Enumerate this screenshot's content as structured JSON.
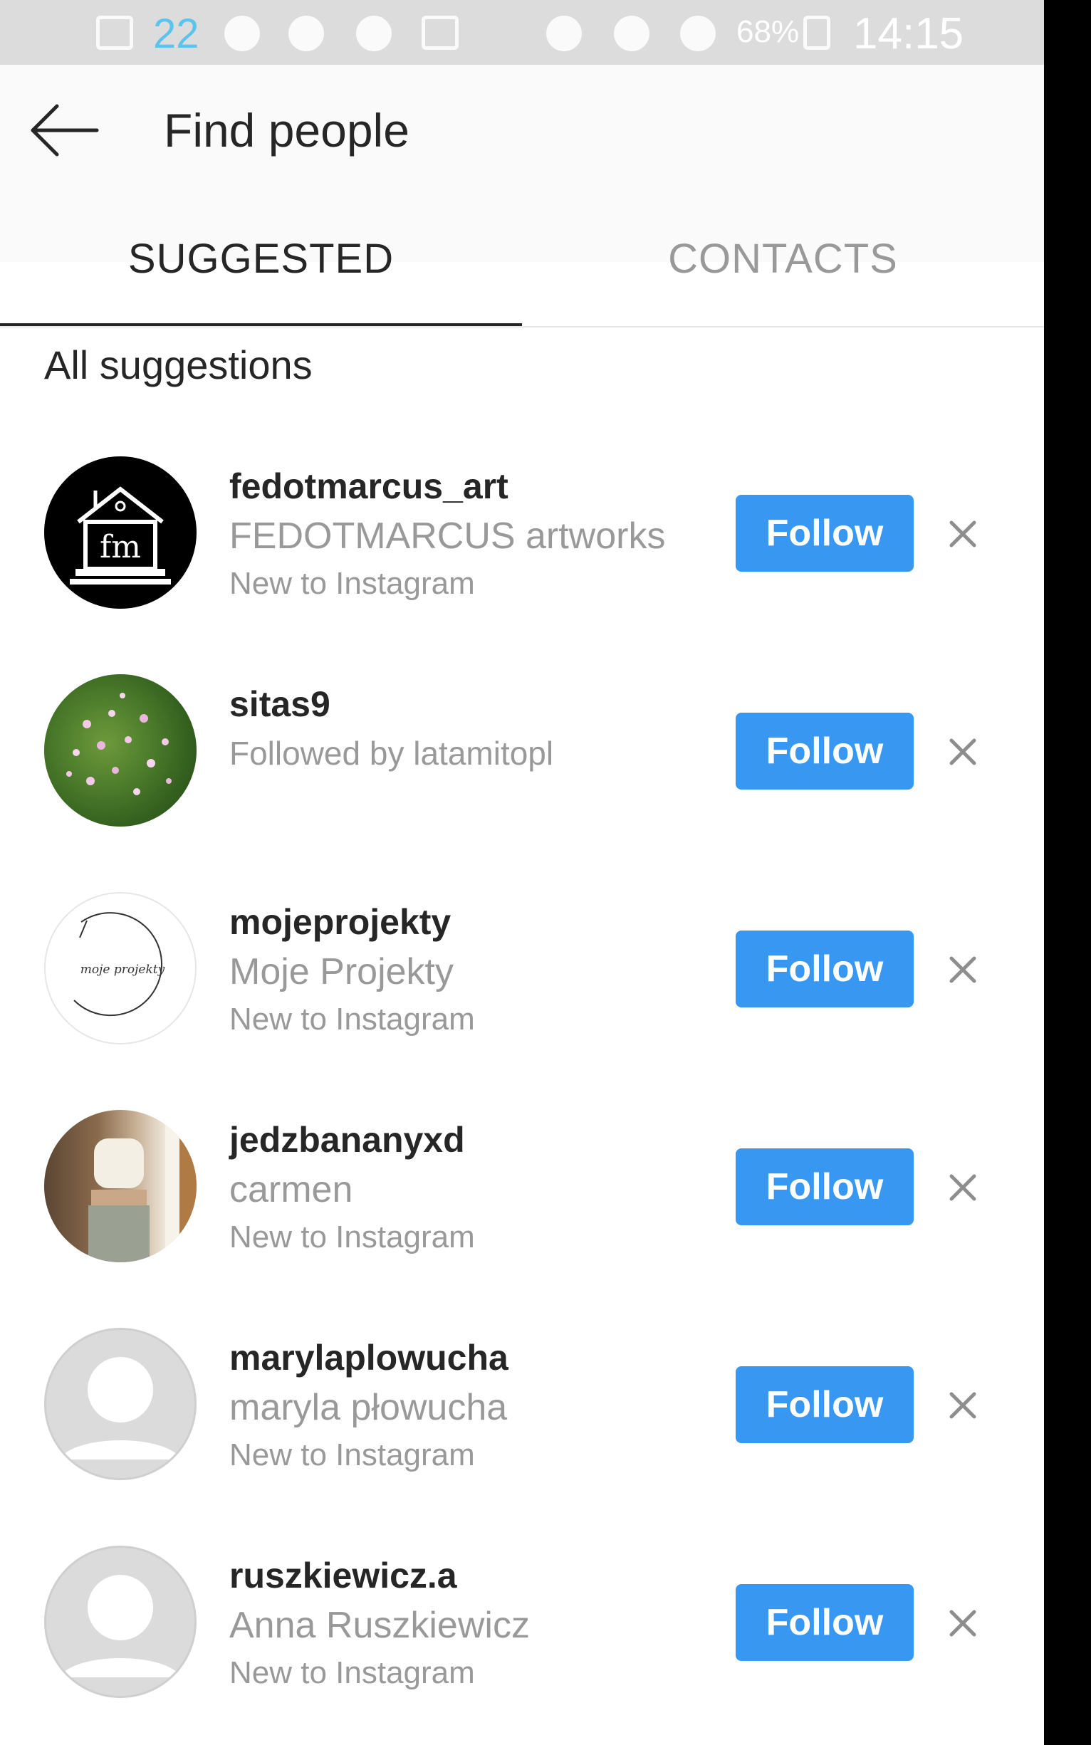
{
  "status_bar": {
    "notification_count": "22",
    "battery": "68%",
    "time": "14:15"
  },
  "header": {
    "back_icon": "arrow-left-icon",
    "title": "Find people"
  },
  "tabs": [
    {
      "label": "SUGGESTED",
      "selected": true
    },
    {
      "label": "CONTACTS",
      "selected": false
    }
  ],
  "section_title": "All suggestions",
  "colors": {
    "follow_button": "#3897f0",
    "primary_text": "#262626",
    "secondary_text": "#999999"
  },
  "suggestions": [
    {
      "username": "fedotmarcus_art",
      "full_name": "FEDOTMARCUS artworks",
      "subtitle": "New to Instagram",
      "avatar": "fm-logo-house",
      "follow_label": "Follow"
    },
    {
      "username": "sitas9",
      "full_name": "",
      "subtitle": "Followed by latamitopl",
      "avatar": "pink-flowers-photo",
      "follow_label": "Follow"
    },
    {
      "username": "mojeprojekty",
      "full_name": "Moje Projekty",
      "subtitle": "New to Instagram",
      "avatar": "moje-projekty-logo",
      "avatar_text": "moje projekty",
      "follow_label": "Follow"
    },
    {
      "username": "jedzbananyxd",
      "full_name": "carmen",
      "subtitle": "New to Instagram",
      "avatar": "person-photo",
      "follow_label": "Follow"
    },
    {
      "username": "marylaplowucha",
      "full_name": "maryla płowucha",
      "subtitle": "New to Instagram",
      "avatar": "default-avatar",
      "follow_label": "Follow"
    },
    {
      "username": "ruszkiewicz.a",
      "full_name": "Anna Ruszkiewicz",
      "subtitle": "New to Instagram",
      "avatar": "default-avatar",
      "follow_label": "Follow"
    }
  ]
}
